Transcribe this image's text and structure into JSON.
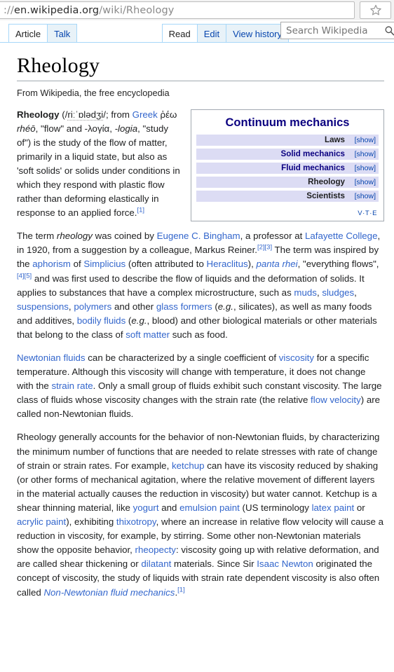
{
  "browser": {
    "url_prefix": "://",
    "url_host": "en.wikipedia.org",
    "url_path": "/wiki/Rheology",
    "bookmark_icon": "star-outline-icon"
  },
  "wiki_nav": {
    "left_tabs": [
      {
        "label": "Article",
        "active": true
      },
      {
        "label": "Talk",
        "active": false
      }
    ],
    "right_tabs": [
      {
        "label": "Read",
        "active": true
      },
      {
        "label": "Edit",
        "active": false
      },
      {
        "label": "View history",
        "active": false
      }
    ],
    "search": {
      "placeholder": "Search Wikipedia",
      "value": "",
      "icon": "magnifier-icon"
    }
  },
  "article": {
    "title": "Rheology",
    "tagline": "From Wikipedia, the free encyclopedia"
  },
  "infobox": {
    "title": "Continuum mechanics",
    "rows": [
      {
        "label": "Laws",
        "link": false,
        "toggle": "[show]"
      },
      {
        "label": "Solid mechanics",
        "link": true,
        "toggle": "[show]"
      },
      {
        "label": "Fluid mechanics",
        "link": true,
        "toggle": "[show]"
      },
      {
        "label": "Rheology",
        "link": false,
        "toggle": "[show]"
      },
      {
        "label": "Scientists",
        "link": false,
        "toggle": "[show]"
      }
    ],
    "footer": {
      "v": "V",
      "sep1": "·",
      "t": "T",
      "sep2": "·",
      "e": "E"
    }
  },
  "paragraphs": {
    "p1": {
      "term": "Rheology",
      "open_paren": " (/",
      "ipa": "riːˈɒlədʒi",
      "ipa_close": "/; from ",
      "greek_link": "Greek",
      "greek_word": " ῥέω ",
      "rheo": "rhéō",
      "flow": ", \"flow\" and -λογία, ",
      "logia": "-logia",
      "studyof": ", \"study of\") is the study of the flow of matter, primarily in a liquid state, but also as 'soft solids' or solids under conditions in which they respond with plastic flow rather than deforming elastically in response to an applied force.",
      "ref": "[1]"
    },
    "p2": {
      "t1": "The term ",
      "rheology_i": "rheology",
      "t2": " was coined by ",
      "bingham": "Eugene C. Bingham",
      "t3": ", a professor at ",
      "lafayette": "Lafayette College",
      "t4": ", in 1920, from a suggestion by a colleague, Markus Reiner.",
      "ref23": "[2][3]",
      "t5": " The term was inspired by the ",
      "aphorism": "aphorism",
      "t6": " of ",
      "simplicius": "Simplicius",
      "t7": " (often attributed to ",
      "heraclitus": "Heraclitus",
      "t8": "), ",
      "panta_rhei": "panta rhei",
      "t9": ", \"everything flows\",",
      "ref45": "[4][5]",
      "t10": " and was first used to describe the flow of liquids and the deformation of solids. It applies to substances that have a complex microstructure, such as ",
      "muds": "muds",
      "t11": ", ",
      "sludges": "sludges",
      "t12": ", ",
      "suspensions": "suspensions",
      "t13": ", ",
      "polymers": "polymers",
      "t14": " and other ",
      "glass_formers": "glass formers",
      "t15": " (",
      "eg1": "e.g.",
      "t16": ", silicates), as well as many foods and additives, ",
      "bodily_fluids": "bodily fluids",
      "t17": " (",
      "eg2": "e.g.",
      "t18": ", blood) and other biological materials or other materials that belong to the class of ",
      "soft_matter": "soft matter",
      "t19": " such as food."
    },
    "p3": {
      "newtonian": "Newtonian fluids",
      "t1": " can be characterized by a single coefficient of ",
      "viscosity": "viscosity",
      "t2": " for a specific temperature. Although this viscosity will change with temperature, it does not change with the ",
      "strain_rate": "strain rate",
      "t3": ". Only a small group of fluids exhibit such constant viscosity. The large class of fluids whose viscosity changes with the strain rate (the relative ",
      "flow_velocity": "flow velocity",
      "t4": ") are called non-Newtonian fluids."
    },
    "p4": {
      "t1": "Rheology generally accounts for the behavior of non-Newtonian fluids, by characterizing the minimum number of functions that are needed to relate stresses with rate of change of strain or strain rates. For example, ",
      "ketchup": "ketchup",
      "t2": " can have its viscosity reduced by shaking (or other forms of mechanical agitation, where the relative movement of different layers in the material actually causes the reduction in viscosity) but water cannot. Ketchup is a shear thinning material, like ",
      "yogurt": "yogurt",
      "t3": " and ",
      "emulsion_paint": "emulsion paint",
      "t4": " (US terminology ",
      "latex_paint": "latex paint",
      "t5": " or ",
      "acrylic_paint": "acrylic paint",
      "t6": "), exhibiting ",
      "thixotropy": "thixotropy",
      "t7": ", where an increase in relative flow velocity will cause a reduction in viscosity, for example, by stirring. Some other non-Newtonian materials show the opposite behavior, ",
      "rheopecty": "rheopecty",
      "t8": ": viscosity going up with relative deformation, and are called shear thickening or ",
      "dilatant": "dilatant",
      "t9": " materials. Since Sir ",
      "isaac_newton": "Isaac Newton",
      "t10": " originated the concept of viscosity, the study of liquids with strain rate dependent viscosity is also often called ",
      "nnfm": "Non-Newtonian fluid mechanics",
      "t11": ".",
      "ref1": "[1]"
    }
  },
  "colors": {
    "link": "#3366cc",
    "link_dark": "#0b0080",
    "infobox_row_bg": "#dcdcf4",
    "tab_blue": "#a7d7f9",
    "text": "#202122"
  }
}
